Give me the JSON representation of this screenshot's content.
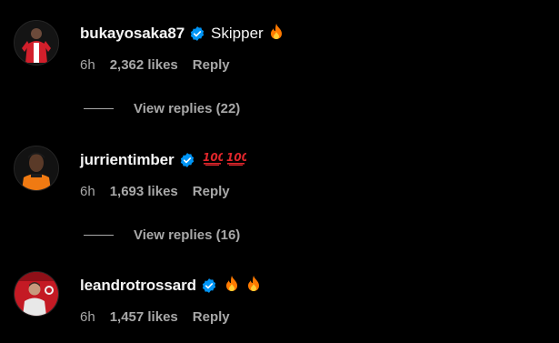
{
  "comments": [
    {
      "username": "bukayosaka87",
      "text": "Skipper",
      "emojis": [
        "fire"
      ],
      "time": "6h",
      "likes": "2,362 likes",
      "reply_label": "Reply",
      "view_replies": "View replies (22)"
    },
    {
      "username": "jurrientimber",
      "text": "",
      "emojis": [
        "hundred",
        "hundred"
      ],
      "time": "6h",
      "likes": "1,693 likes",
      "reply_label": "Reply",
      "view_replies": "View replies (16)"
    },
    {
      "username": "leandrotrossard",
      "text": "",
      "emojis": [
        "fire",
        "fire"
      ],
      "time": "6h",
      "likes": "1,457 likes",
      "reply_label": "Reply"
    }
  ],
  "colors": {
    "background": "#000000",
    "primary_text": "#f5f5f5",
    "secondary_text": "#a8a8a8",
    "verified_blue": "#0095f6",
    "fire_orange": "#ff7a00",
    "hundred_red": "#e0262b"
  }
}
